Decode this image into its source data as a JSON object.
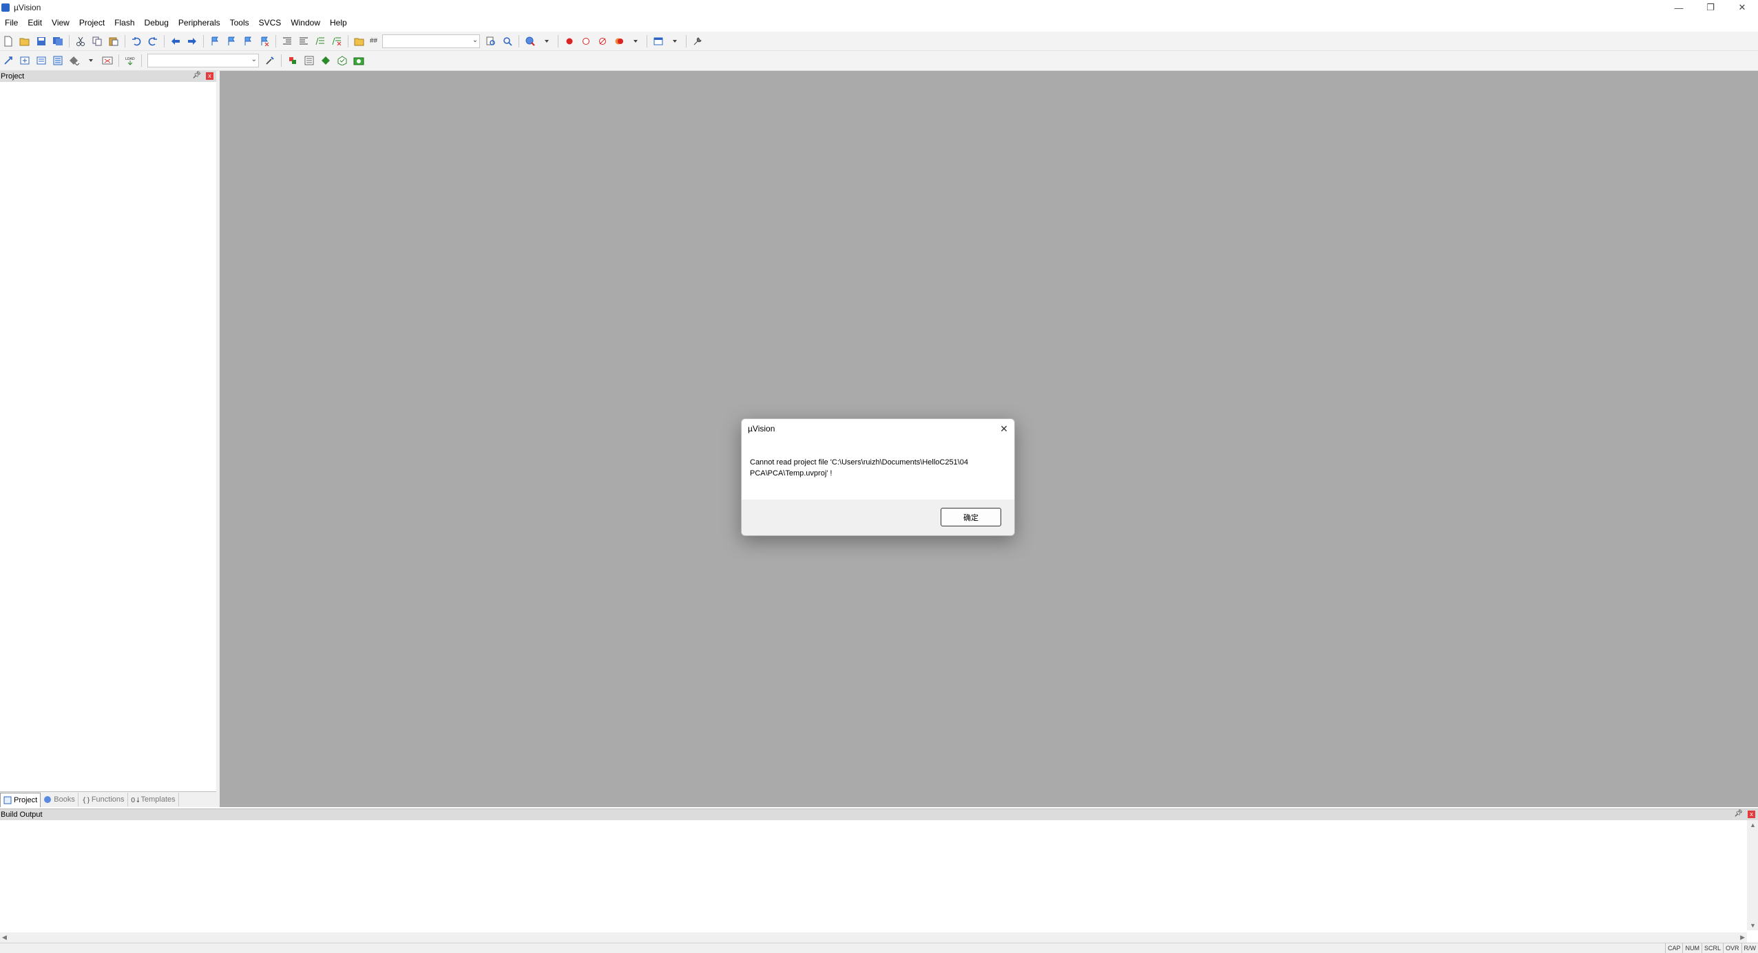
{
  "window": {
    "title": "µVision",
    "minimize": "—",
    "restore": "❐",
    "close": "✕"
  },
  "menu": [
    "File",
    "Edit",
    "View",
    "Project",
    "Flash",
    "Debug",
    "Peripherals",
    "Tools",
    "SVCS",
    "Window",
    "Help"
  ],
  "toolbar": {
    "find_text": "##"
  },
  "project_panel": {
    "title": "Project",
    "tabs": [
      {
        "label": "Project",
        "icon": "project-icon",
        "active": true
      },
      {
        "label": "Books",
        "icon": "books-icon",
        "active": false
      },
      {
        "label": "Functions",
        "icon": "functions-icon",
        "active": false
      },
      {
        "label": "Templates",
        "icon": "templates-icon",
        "active": false
      }
    ]
  },
  "build_output": {
    "title": "Build Output"
  },
  "statusbar": {
    "indicators": [
      "CAP",
      "NUM",
      "SCRL",
      "OVR",
      "R/W"
    ]
  },
  "dialog": {
    "title": "µVision",
    "message_line1": "Cannot read project file 'C:\\Users\\ruizh\\Documents\\HelloC251\\04",
    "message_line2": "PCA\\PCA\\Temp.uvproj' !",
    "ok_label": "确定"
  },
  "colors": {
    "workspace": "#aaaaaa",
    "panel_header": "#dcdcdc",
    "close_red": "#e23c3c"
  }
}
